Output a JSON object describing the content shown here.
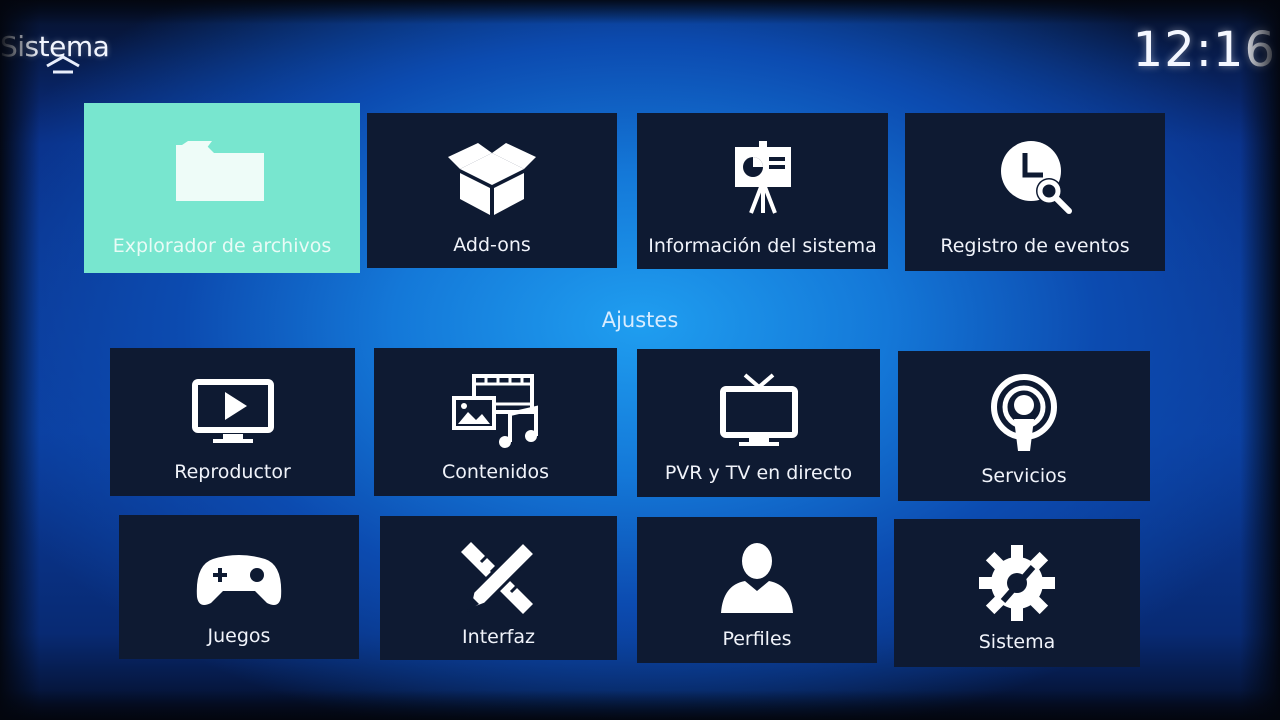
{
  "header": {
    "title": "Sistema",
    "time": "12:16"
  },
  "top_row": [
    {
      "label": "Explorador de archivos",
      "icon": "folder-icon",
      "focused": true
    },
    {
      "label": "Add-ons",
      "icon": "box-icon"
    },
    {
      "label": "Información del sistema",
      "icon": "presentation-board-icon"
    },
    {
      "label": "Registro de eventos",
      "icon": "clock-search-icon"
    }
  ],
  "section": {
    "label": "Ajustes"
  },
  "settings": [
    {
      "label": "Reproductor",
      "icon": "monitor-play-icon"
    },
    {
      "label": "Contenidos",
      "icon": "media-library-icon"
    },
    {
      "label": "PVR y TV en directo",
      "icon": "tv-antenna-icon"
    },
    {
      "label": "Servicios",
      "icon": "podcast-broadcast-icon"
    },
    {
      "label": "Juegos",
      "icon": "gamepad-icon"
    },
    {
      "label": "Interfaz",
      "icon": "pencil-ruler-icon"
    },
    {
      "label": "Perfiles",
      "icon": "user-profile-icon"
    },
    {
      "label": "Sistema",
      "icon": "gear-wrench-icon"
    }
  ],
  "colors": {
    "focus": "#78e6cf",
    "tile": "#0e1a32",
    "background_glow": "#1f9ef0"
  }
}
